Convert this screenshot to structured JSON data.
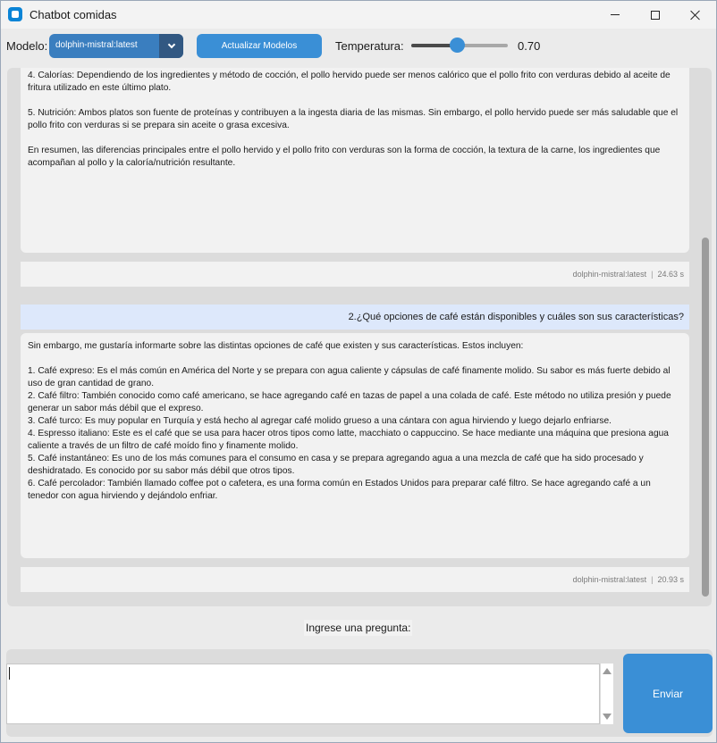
{
  "window": {
    "title": "Chatbot comidas"
  },
  "toolbar": {
    "model_label": "Modelo:",
    "model_value": "dolphin-mistral:latest",
    "update_button": "Actualizar Modelos",
    "temperature_label": "Temperatura:",
    "temperature_value": "0.70",
    "temperature_fraction": 0.7
  },
  "conversation": {
    "answer1": [
      "4. Calorías: Dependiendo de los ingredientes y método de cocción, el pollo hervido puede ser menos calórico que el pollo frito con verduras debido al aceite de fritura utilizado en este último plato.",
      "",
      "5. Nutrición: Ambos platos son fuente de proteínas y contribuyen a la ingesta diaria de las mismas. Sin embargo, el pollo hervido puede ser más saludable que el pollo frito con verduras si se prepara sin aceite o grasa excesiva.",
      "",
      "En resumen, las diferencias principales entre el pollo hervido y el pollo frito con verduras son la forma de cocción, la textura de la carne, los ingredientes que acompañan al pollo y la caloría/nutrición resultante."
    ],
    "meta1": {
      "model": "dolphin-mistral:latest",
      "separator": "|",
      "time": "24.63 s"
    },
    "question2": "2.¿Qué opciones de café están disponibles y cuáles son sus características?",
    "answer2": [
      "Sin embargo, me gustaría informarte sobre las distintas opciones de café que existen y sus características. Estos incluyen:",
      "",
      "1. Café expreso: Es el más común en América del Norte y se prepara con agua caliente y cápsulas de café finamente molido. Su sabor es más fuerte debido al uso de gran cantidad de grano.",
      "2. Café filtro: También conocido como café americano, se hace agregando café en tazas de papel a una colada de café. Este método no utiliza presión y puede generar un sabor más débil que el expreso.",
      "3. Café turco: Es muy popular en Turquía y está hecho al agregar café molido grueso a una cántara con agua hirviendo y luego dejarlo enfriarse.",
      "4. Espresso italiano: Este es el café que se usa para hacer otros tipos como latte, macchiato o cappuccino. Se hace mediante una máquina que presiona agua caliente a través de un filtro de café moído fino y finamente molido.",
      "5. Café instantáneo: Es uno de los más comunes para el consumo en casa y se prepara agregando agua a una mezcla de café que ha sido procesado y deshidratado. Es conocido por su sabor más débil que otros tipos.",
      "6. Café percolador: También llamado coffee pot o cafetera, es una forma común en Estados Unidos para preparar café filtro. Se hace agregando café a un tenedor con agua hirviendo y dejándolo enfriar."
    ],
    "meta2": {
      "model": "dolphin-mistral:latest",
      "separator": "|",
      "time": "20.93 s"
    }
  },
  "input": {
    "prompt_label": "Ingrese una pregunta:",
    "value": "",
    "send_button": "Enviar"
  },
  "colors": {
    "accent": "#3a8fd6",
    "select_bg": "#3a7ebf",
    "question_bg": "#dde8fb"
  }
}
